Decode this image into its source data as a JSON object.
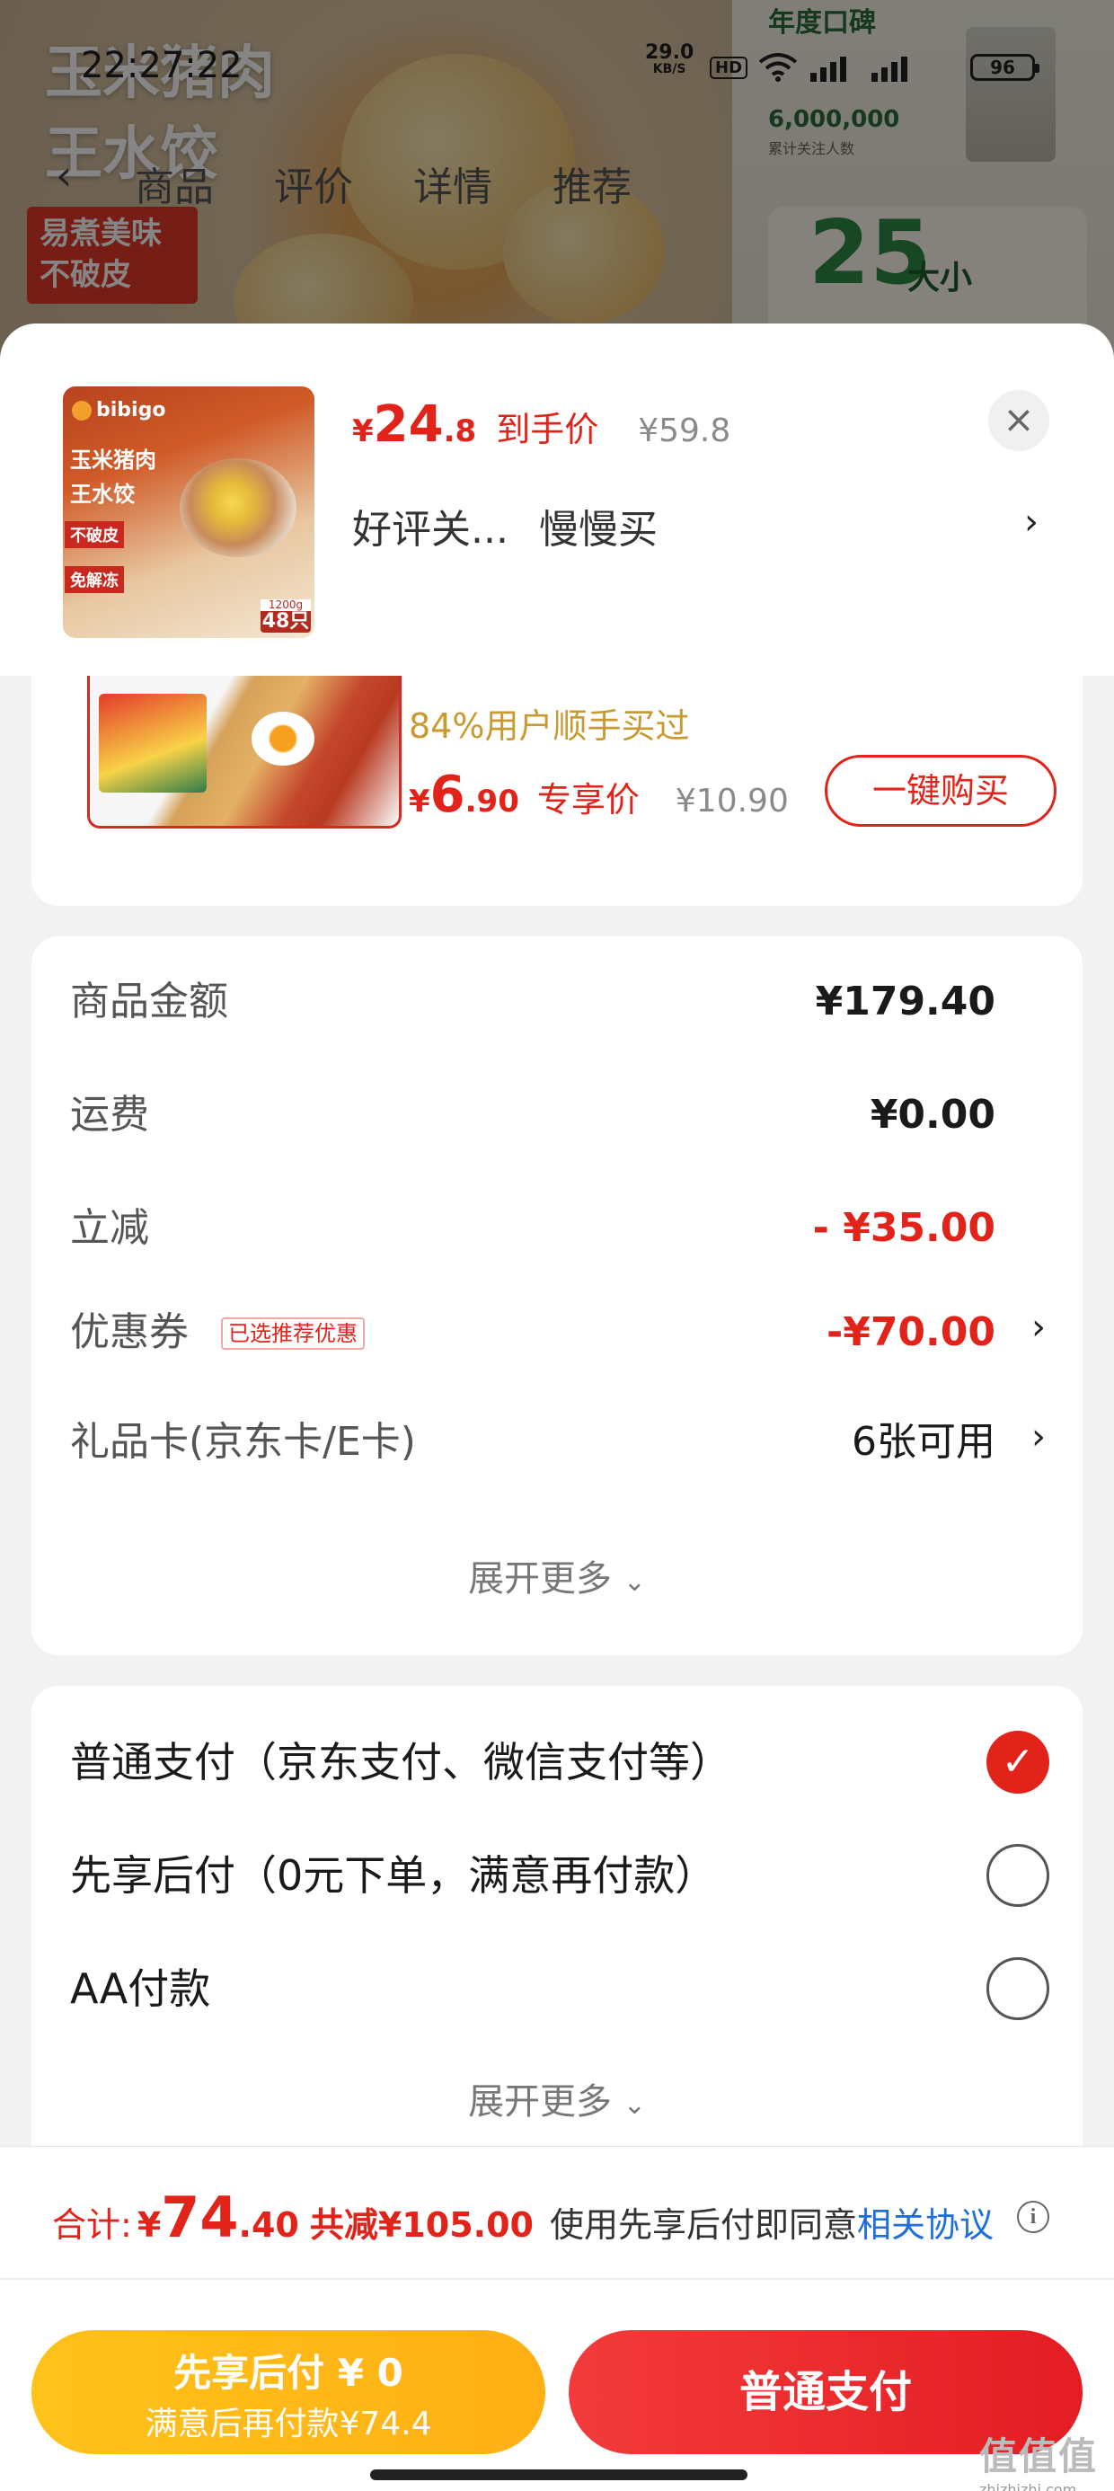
{
  "status_bar": {
    "time": "22:27:22",
    "net_speed": "29.0",
    "net_unit": "KB/S",
    "hd": "HD",
    "battery": "96"
  },
  "background_page": {
    "title_line1": "玉米猪肉",
    "title_line2": "王水饺",
    "tag_line1": "易煮美味",
    "tag_line2": "不破皮",
    "nav_tabs": [
      "商品",
      "评价",
      "详情",
      "推荐"
    ],
    "right_title": "年度口碑",
    "right_number": "6,000,000",
    "right_sub": "累计关注人数",
    "right_big": "25",
    "right_da": "大小"
  },
  "product": {
    "thumb_brand": "bibigo",
    "thumb_line1": "玉米猪肉",
    "thumb_line2": "王水饺",
    "thumb_tag1": "不破皮",
    "thumb_tag2": "免解冻",
    "thumb_weight": "1200g",
    "thumb_count": "48只",
    "currency": "¥",
    "price_int": "24",
    "price_dec": ".8",
    "price_label": "到手价",
    "orig_price": "¥59.8",
    "spec_1": "好评关...",
    "spec_2": "慢慢买"
  },
  "recommend": {
    "subtitle": "84%用户顺手买过",
    "currency": "¥",
    "price_int": "6",
    "price_dec": ".90",
    "price_label": "专享价",
    "orig_price": "¥10.90",
    "buy_label": "一键购买"
  },
  "summary": {
    "rows": [
      {
        "label": "商品金额",
        "value": "¥179.40"
      },
      {
        "label": "运费",
        "value": "¥0.00"
      },
      {
        "label": "立减",
        "value": "- ¥35.00"
      },
      {
        "label": "优惠券",
        "tag": "已选推荐优惠",
        "value": "-¥70.00"
      },
      {
        "label": "礼品卡(京东卡/E卡)",
        "value": "6张可用"
      }
    ],
    "expand_label": "展开更多"
  },
  "payment": {
    "options": [
      {
        "label": "普通支付（京东支付、微信支付等）",
        "selected": true
      },
      {
        "label": "先享后付（0元下单，满意再付款）",
        "selected": false
      },
      {
        "label": "AA付款",
        "selected": false
      }
    ],
    "expand_label": "展开更多"
  },
  "footer": {
    "total_label": "合计:",
    "currency": "¥",
    "total_int": "74",
    "total_dec": ".40",
    "saved": "共减¥105.00",
    "agree_text": "使用先享后付即同意",
    "agree_link": "相关协议",
    "btn_later_l1": "先享后付 ¥ 0",
    "btn_later_l2": "满意后再付款¥74.4",
    "btn_pay": "普通支付"
  },
  "watermark": {
    "text": "值值值",
    "url": "zhizhizhi.com"
  },
  "colors": {
    "accent_red": "#e2231a",
    "accent_yellow": "#ffb015",
    "link_blue": "#1e6fd9"
  }
}
